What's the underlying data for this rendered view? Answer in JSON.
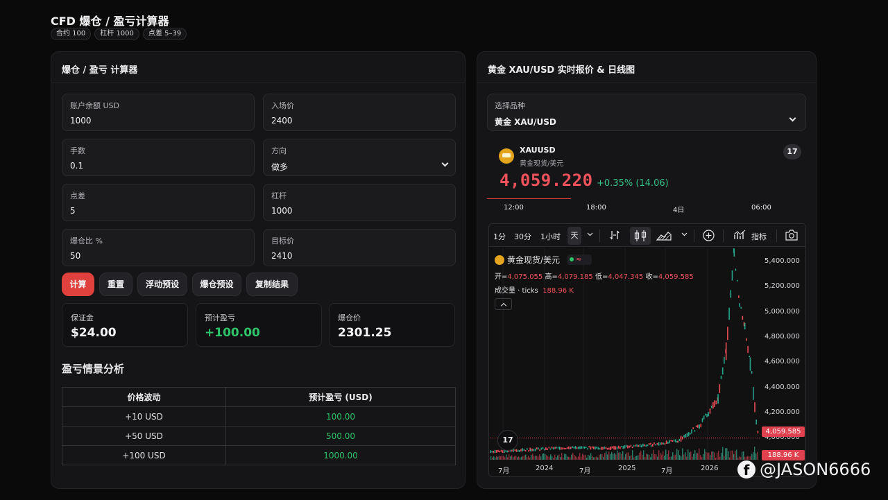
{
  "app": {
    "title": "CFD 爆仓 / 盈亏计算器",
    "badges": [
      "合约 100",
      "杠杆 1000",
      "点差 5–39"
    ]
  },
  "calculator": {
    "header": "爆仓 / 盈亏 计算器",
    "fields": {
      "balance": {
        "label": "账户余额 USD",
        "value": "1000"
      },
      "entry": {
        "label": "入场价",
        "value": "2400"
      },
      "lots": {
        "label": "手数",
        "value": "0.1"
      },
      "direction": {
        "label": "方向",
        "value": "做多"
      },
      "spread": {
        "label": "点差",
        "value": "5"
      },
      "leverage": {
        "label": "杠杆",
        "value": "1000"
      },
      "liq_ratio": {
        "label": "爆仓比 %",
        "value": "50"
      },
      "target": {
        "label": "目标价",
        "value": "2410"
      }
    },
    "buttons": {
      "calc": "计算",
      "reset": "重置",
      "float_preset": "浮动预设",
      "liq_preset": "爆仓预设",
      "copy": "复制结果"
    },
    "results": {
      "margin": {
        "label": "保证金",
        "value": "$24.00"
      },
      "pnl": {
        "label": "预计盈亏",
        "value": "+100.00"
      },
      "liq_price": {
        "label": "爆仓价",
        "value": "2301.25"
      }
    },
    "scenario": {
      "title": "盈亏情景分析",
      "headers": [
        "价格波动",
        "预计盈亏 (USD)"
      ],
      "rows": [
        [
          "+10 USD",
          "100.00"
        ],
        [
          "+50 USD",
          "500.00"
        ],
        [
          "+100 USD",
          "1000.00"
        ]
      ]
    }
  },
  "quote": {
    "header": "黄金 XAU/USD 实时报价 & 日线图",
    "select": {
      "label": "选择品种",
      "value": "黄金 XAU/USD"
    },
    "symbol": "XAUUSD",
    "symbol_name": "黄金现货/美元",
    "tv_logo": "17",
    "price": "4,059.220",
    "change": "+0.35% (14.06)",
    "mini_times": [
      "12:00",
      "18:00",
      "4日",
      "06:00"
    ],
    "colors": {
      "up": "#38c38a",
      "down": "#f0525b",
      "accent": "#e0413c",
      "gold": "#e3a51d"
    }
  },
  "chart": {
    "toolbar": [
      "1分",
      "30分",
      "1小时",
      "天",
      "指标"
    ],
    "legend_title": "黄金现货/美元",
    "status_symbol": "≈",
    "ohlc": {
      "open_label": "开=",
      "open": "4,075.055",
      "high_label": "高=",
      "high": "4,079.185",
      "low_label": "低=",
      "low": "4,047.345",
      "close_label": "收=",
      "close": "4,059.585"
    },
    "volume_label": "成交量 · ticks",
    "volume_value": "188.96 K",
    "price_tag": "4,059.585",
    "volume_tag": "188.96 K",
    "chart_data": {
      "type": "line",
      "y_ticks": [
        "5,400.000",
        "5,200.000",
        "5,000.000",
        "4,800.000",
        "4,600.000",
        "4,400.000",
        "4,200.000",
        "4,000.000"
      ],
      "ylim": [
        3900,
        5460
      ],
      "x_ticks": [
        "7月",
        "2024",
        "7月",
        "2025",
        "7月",
        "2026"
      ],
      "x": [
        0,
        15,
        30,
        45,
        60,
        70,
        78,
        85,
        88,
        91,
        93,
        95,
        97,
        100
      ],
      "values": [
        3960,
        3975,
        3990,
        3985,
        4010,
        4040,
        4150,
        4350,
        4700,
        5430,
        5050,
        4880,
        4600,
        4059
      ]
    },
    "tv_logo": "17"
  },
  "watermark": "@JASON6666"
}
